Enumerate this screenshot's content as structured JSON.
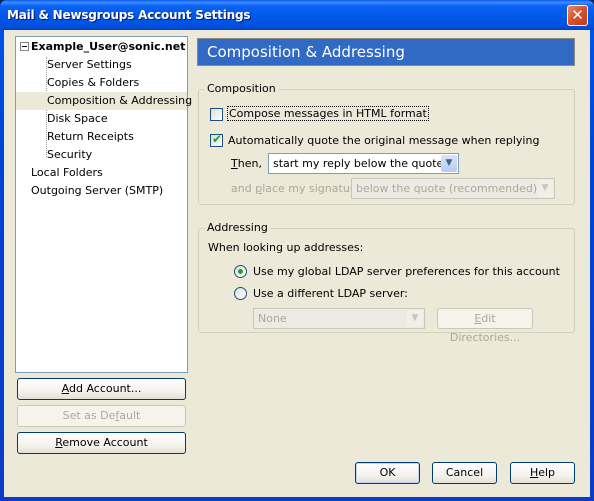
{
  "window": {
    "title": "Mail & Newsgroups Account Settings",
    "close_icon": "close-x-icon"
  },
  "tree": {
    "root": {
      "label": "Example_User@sonic.net",
      "expander": "minus-expander-icon"
    },
    "children": [
      {
        "label": "Server Settings",
        "selected": false
      },
      {
        "label": "Copies & Folders",
        "selected": false
      },
      {
        "label": "Composition & Addressing",
        "selected": true
      },
      {
        "label": "Disk Space",
        "selected": false
      },
      {
        "label": "Return Receipts",
        "selected": false
      },
      {
        "label": "Security",
        "selected": false
      }
    ],
    "top_level": [
      {
        "label": "Local Folders"
      },
      {
        "label": "Outgoing Server (SMTP)"
      }
    ]
  },
  "account_buttons": {
    "add_account": {
      "prefix": "",
      "accel": "A",
      "rest": "dd Account..."
    },
    "set_default": {
      "prefix": "Set as De",
      "accel": "f",
      "rest": "ault",
      "disabled": true
    },
    "remove_account": {
      "prefix": "",
      "accel": "R",
      "rest": "emove Account"
    }
  },
  "panel": {
    "title": "Composition & Addressing",
    "composition": {
      "legend": "Composition",
      "html_format": {
        "label": "Compose messages in HTML format",
        "checked": false
      },
      "auto_quote": {
        "label": "Automatically quote the original message when replying",
        "checked": true
      },
      "then_label_accel": "T",
      "then_label_rest": "hen,",
      "reply_position": {
        "value": "start my reply below the quote"
      },
      "signature_label_prefix": "and ",
      "signature_label_accel": "p",
      "signature_label_rest": "lace my signature",
      "signature_position": {
        "value": "below the quote (recommended)",
        "disabled": true
      }
    },
    "addressing": {
      "legend": "Addressing",
      "lookup_label": "When looking up addresses:",
      "use_global": {
        "label": "Use my global LDAP server preferences for this account",
        "selected": true
      },
      "use_different": {
        "label": "Use a different LDAP server:",
        "selected": false
      },
      "ldap_server": {
        "value": "None",
        "disabled": true
      },
      "edit_directories": {
        "accel": "E",
        "rest": "dit Directories...",
        "disabled": true
      }
    }
  },
  "dialog_buttons": {
    "ok": "OK",
    "cancel": "Cancel",
    "help_accel": "H",
    "help_rest": "elp"
  },
  "colors": {
    "header_bg": "#316ac5",
    "titlebar": "#0054e3",
    "check_green": "#21a121"
  }
}
